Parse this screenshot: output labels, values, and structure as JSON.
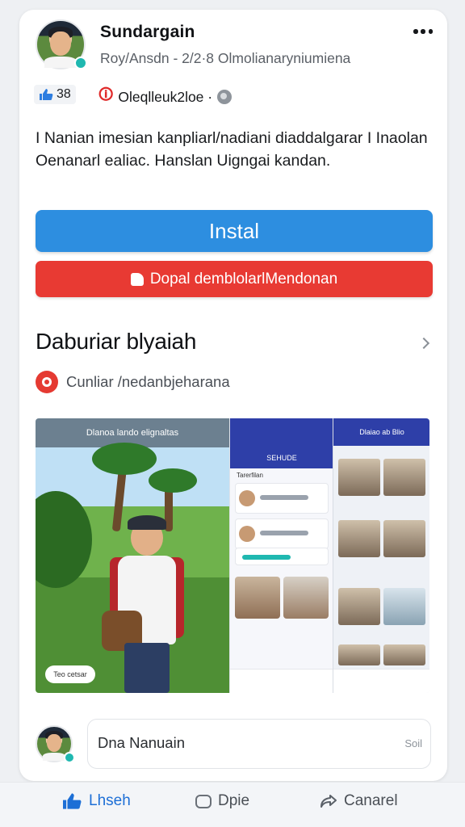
{
  "post": {
    "app_name": "Sundargain",
    "sub_line": "Roy/Ansdn  -  2/2·8  Olmolianaryniumiena",
    "likes_count": "38",
    "meta_text": "Oleqlleuk2loe ·",
    "body_text": "I Nanian imesian kanpliarl/nadiani diaddalgarar I Inaolan Oenanarl ealiac. Hanslan Uigngai kandan."
  },
  "buttons": {
    "install_label": "Instal",
    "secondary_label": "Dopal demblolarlMendonan",
    "secondary_color": "#e83a33",
    "install_color": "#2d8ee0"
  },
  "section": {
    "title": "Daburiar blyaiah",
    "developer_text": "Cunliar /nedanbjeharana"
  },
  "screenshots": {
    "shot1_header": "Dlanoa lando elignaltas",
    "shot1_pill": "Teo cetsar",
    "shot2_header": "SEHUDE",
    "shot2_subheader": "Tarerfilan",
    "shot3_header": "Dlaiao ab Blio"
  },
  "comment": {
    "placeholder": "Dna Nanuain",
    "send_label": "Soil"
  },
  "bottom_actions": {
    "like_label": "Lhseh",
    "comment_label": "Dpie",
    "share_label": "Canarel",
    "like_color": "#1d6fd6"
  },
  "icons": [
    "more-icon",
    "thumbs-up-icon",
    "globe-icon",
    "hand-icon",
    "chevron-right-icon",
    "developer-icon",
    "comment-icon",
    "share-icon"
  ]
}
